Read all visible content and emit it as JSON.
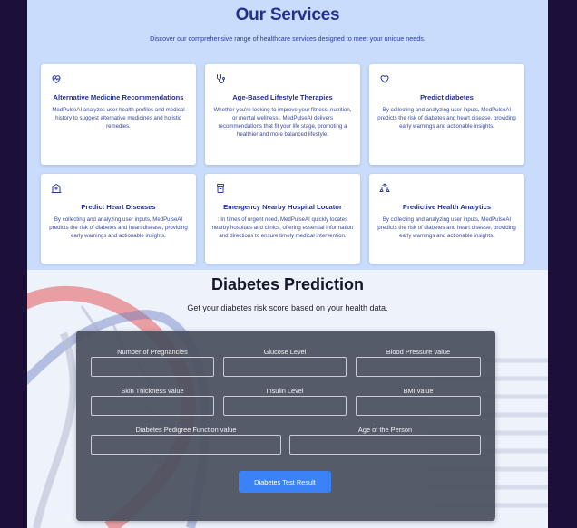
{
  "services": {
    "title": "Our Services",
    "subtitle": "Discover our comprehensive range of healthcare services designed to meet your unique needs.",
    "accent_color": "#23318d",
    "cards": [
      {
        "icon": "heart-pulse-icon",
        "title": "Alternative Medicine Recommendations",
        "description": "MedPulseAI analyzes user health profiles and medical history to suggest alternative medicines and holistic remedies."
      },
      {
        "icon": "stethoscope-icon",
        "title": "Age-Based Lifestyle Therapies",
        "description": "Whether you're looking to improve your fitness, nutrition, or mental wellness , MedPulseAI delivers recommendations that fit your life stage, promoting a healthier and more balanced lifestyle."
      },
      {
        "icon": "heart-icon",
        "title": "Predict diabetes",
        "description": "By collecting and analyzing user inputs, MedPulseAI predicts the risk of diabetes and heart disease, providing early warnings and actionable insights."
      },
      {
        "icon": "hospital-icon",
        "title": "Predict Heart Diseases",
        "description": "By collecting and analyzing user inputs, MedPulseAI predicts the risk of diabetes and heart disease, providing early warnings and actionable insights."
      },
      {
        "icon": "medicine-bottle-icon",
        "title": "Emergency Nearby Hospital Locator",
        "description": ": In times of urgent need, MedPulseAI quickly locates nearby hospitals and clinics, offering essential information and directions to ensure timely medical intervention."
      },
      {
        "icon": "analytics-cycle-icon",
        "title": "Predictive Health Analytics",
        "description": "By collecting and analyzing user inputs, MedPulseAI predicts the risk of diabetes and heart disease, providing early warnings and actionable insights."
      }
    ]
  },
  "prediction": {
    "title": "Diabetes Prediction",
    "subtitle": "Get your diabetes risk score based on your health data.",
    "fields": [
      {
        "label": "Number of Pregnancies",
        "value": ""
      },
      {
        "label": "Glucose Level",
        "value": ""
      },
      {
        "label": "Blood Pressure value",
        "value": ""
      },
      {
        "label": "Skin Thickness value",
        "value": ""
      },
      {
        "label": "Insulin Level",
        "value": ""
      },
      {
        "label": "BMI value",
        "value": ""
      },
      {
        "label": "Diabetes Pedigree Function value",
        "value": ""
      },
      {
        "label": "Age of the Person",
        "value": ""
      }
    ],
    "submit_label": "Diabetes Test Result",
    "button_color": "#3b82f6",
    "panel_color": "#4a505e"
  }
}
